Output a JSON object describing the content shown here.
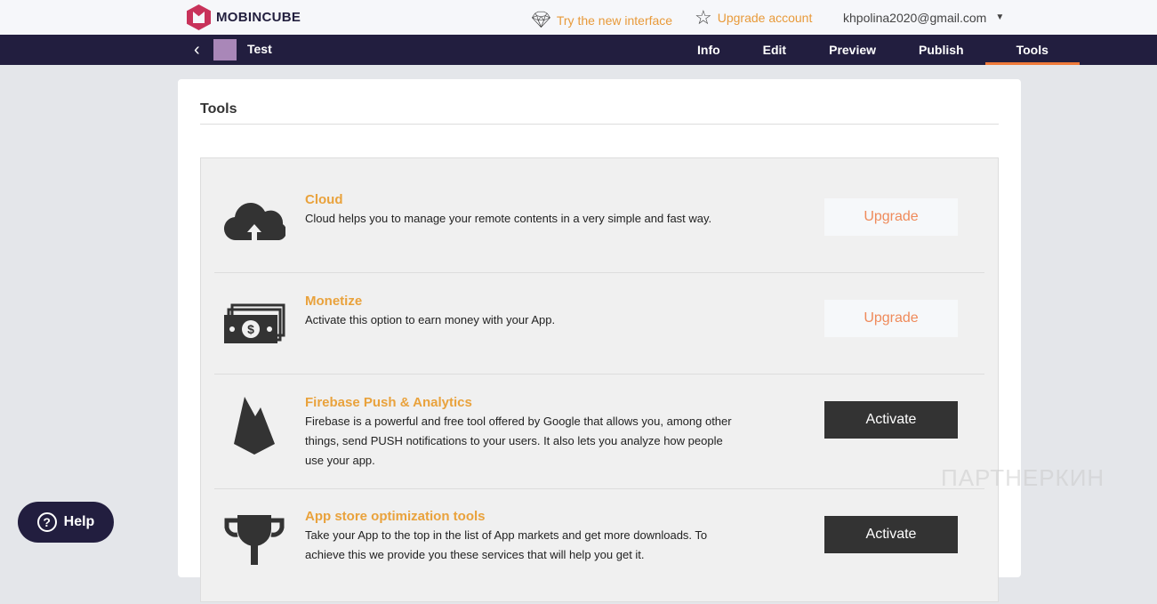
{
  "brand": "MOBINCUBE",
  "top": {
    "try_new": "Try the new interface",
    "upgrade": "Upgrade account",
    "user": "khpolina2020@gmail.com"
  },
  "nav": {
    "app_name": "Test",
    "tabs": [
      "Info",
      "Edit",
      "Preview",
      "Publish",
      "Tools"
    ],
    "active": "Tools"
  },
  "page_title": "Tools",
  "tools": [
    {
      "title": "Cloud",
      "desc": "Cloud helps you to manage your remote contents in a very simple and fast way.",
      "button": "Upgrade"
    },
    {
      "title": "Monetize",
      "desc": "Activate this option to earn money with your App.",
      "button": "Upgrade"
    },
    {
      "title": "Firebase Push & Analytics",
      "desc": "Firebase is a powerful and free tool offered by Google that allows you, among other things, send PUSH notifications to your users. It also lets you analyze how people use your app.",
      "button": "Activate"
    },
    {
      "title": "App store optimization tools",
      "desc": "Take your App to the top in the list of App markets and get more downloads. To achieve this we provide you these services that will help you get it.",
      "button": "Activate"
    }
  ],
  "help": "Help",
  "watermark": "ПАРТНЕРКИН"
}
